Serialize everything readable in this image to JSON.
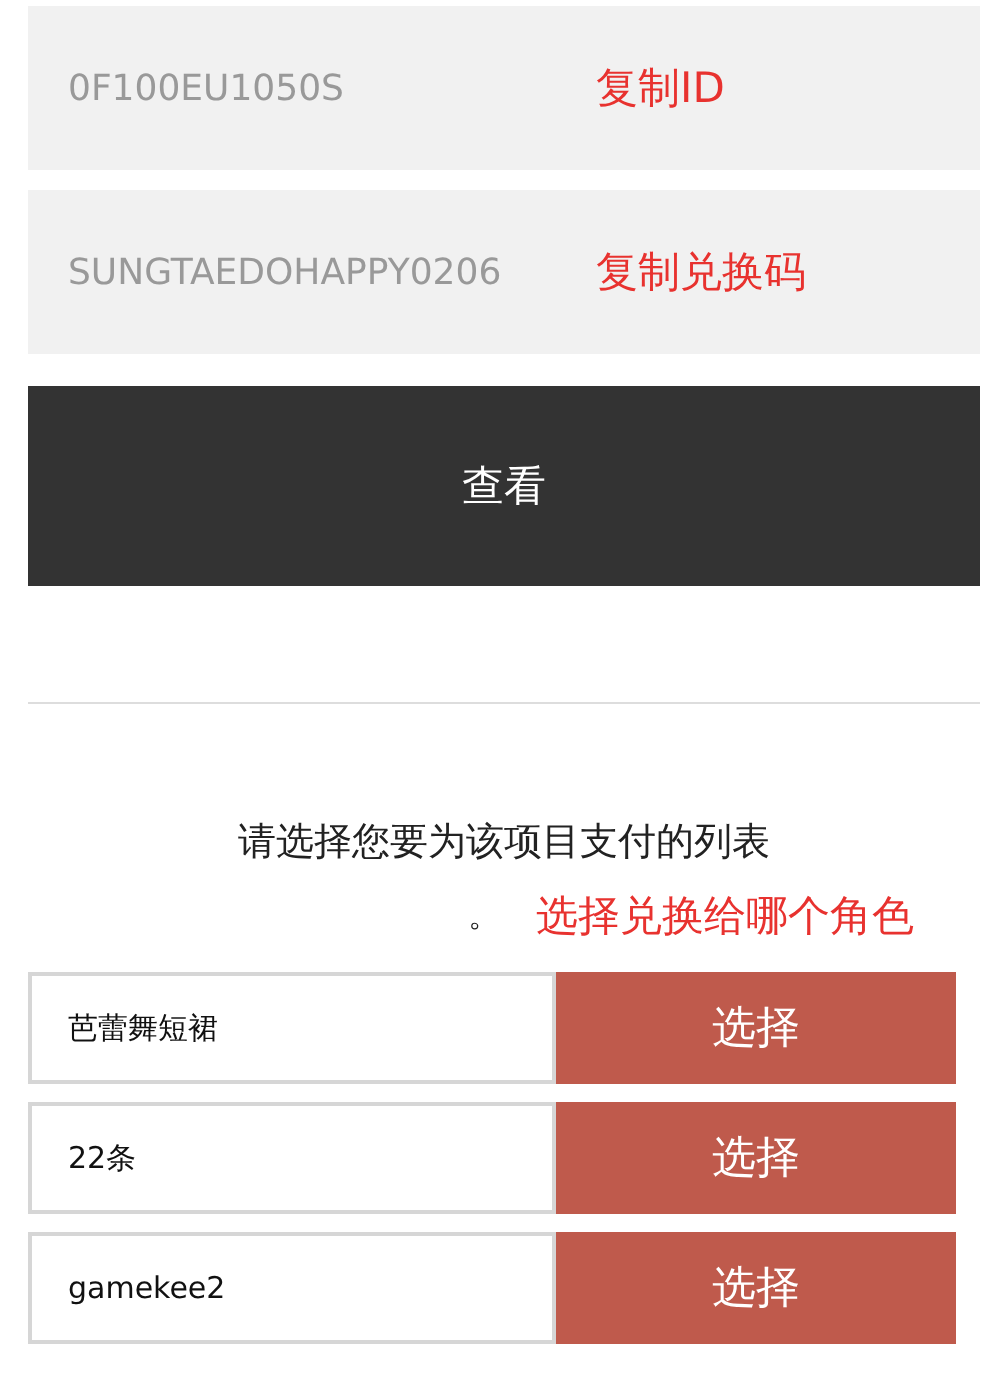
{
  "fields": [
    {
      "value": "0F100EU1050S",
      "note": "复制ID"
    },
    {
      "value": "SUNGTAEDOHAPPY0206",
      "note": "复制兑换码"
    }
  ],
  "view_button": "查看",
  "prompt": {
    "text": "请选择您要为该项目支付的列表",
    "tail": "。",
    "note": "选择兑换给哪个角色"
  },
  "characters": [
    {
      "name": "芭蕾舞短裙",
      "button": "选择"
    },
    {
      "name": "22条",
      "button": "选择"
    },
    {
      "name": "gamekee2",
      "button": "选择"
    }
  ]
}
